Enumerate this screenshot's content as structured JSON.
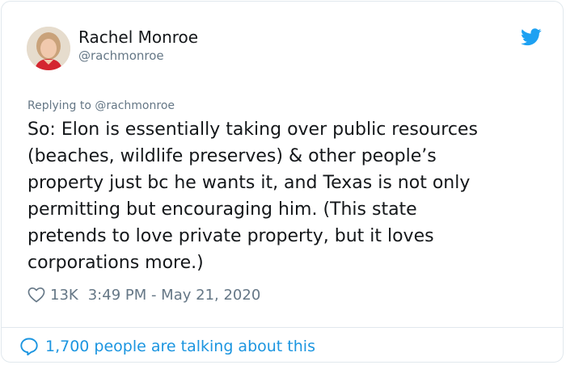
{
  "tweet": {
    "author_name": "Rachel Monroe",
    "author_handle": "@rachmonroe",
    "replying_prefix": "Replying to",
    "replying_to": "@rachmonroe",
    "text_lines": [
      "So: Elon is essentially taking over public resources",
      "(beaches, wildlife preserves) & other people’s",
      "property just bc he wants it, and Texas is not only",
      "permitting but encouraging him. (This state",
      "pretends to love private property, but it loves",
      "corporations more.)"
    ],
    "likes": "13K",
    "timestamp": "3:49 PM - May 21, 2020"
  },
  "footer": {
    "talking_label": "1,700 people are talking about this"
  },
  "icons": {
    "logo": "twitter-bird-icon",
    "like": "heart-icon",
    "reply": "speech-bubble-icon"
  },
  "colors": {
    "twitter_blue": "#1da1f2",
    "link_blue": "#1b95e0",
    "text": "#14171a",
    "secondary": "#657786",
    "border": "#e1e8ed"
  }
}
